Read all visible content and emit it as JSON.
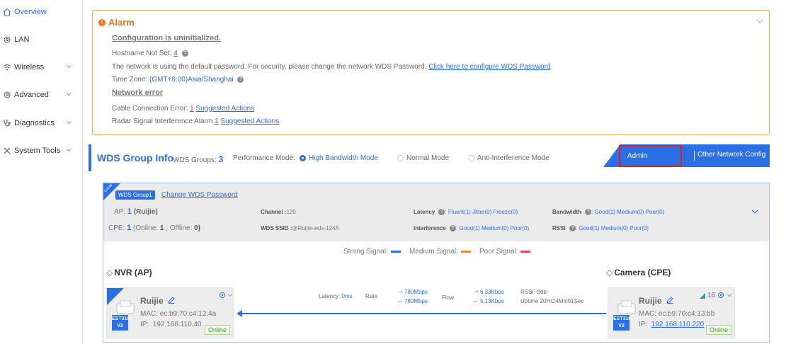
{
  "sidebar": {
    "items": [
      {
        "label": "Overview",
        "icon": "home-icon",
        "active": true
      },
      {
        "label": "LAN",
        "icon": "gear-icon"
      },
      {
        "label": "Wireless",
        "icon": "wifi-icon"
      },
      {
        "label": "Advanced",
        "icon": "gear-icon"
      },
      {
        "label": "Diagnostics",
        "icon": "stethoscope-icon"
      },
      {
        "label": "System Tools",
        "icon": "tools-icon"
      }
    ]
  },
  "alarm": {
    "title": "Alarm",
    "config_head": "Configuration is uninitialized.",
    "hostname_label": "Hostname Not Set:",
    "hostname_count": "4",
    "password_text": "The network is using the default password. For security, please change the network WDS Password.",
    "password_link": "Click here to configure WDS Password",
    "timezone_label": "Time Zone:",
    "timezone_value": "(GMT+8:00)Asia/Shanghai",
    "network_head": "Network error",
    "cable_label": "Cable Connection Error:",
    "cable_count": "1",
    "cable_link": "Suggested Actions",
    "radar_label": "Radar Signal Interference Alarm",
    "radar_count": "1",
    "radar_link": "Suggested Actions"
  },
  "wds": {
    "title": "WDS Group Info",
    "groups_label": "WDS Groups:",
    "groups_count": "3",
    "perf_label": "Performance Mode:",
    "modes": [
      "High Bandwidth Mode",
      "Normal Mode",
      "Anti-Interference Mode"
    ],
    "admin_password": "Admin Password",
    "other_config": "Other Network Config"
  },
  "group": {
    "corner_label": "Local",
    "badge": "WDS Group1",
    "change_link": "Change WDS Password",
    "ap_label": "AP:",
    "ap_count": "1",
    "ap_name": "(Ruijie)",
    "cpe_label": "CPE:",
    "cpe_count": "1",
    "cpe_online_label": "(Online:",
    "cpe_online": "1",
    "cpe_offline_label": ", Offline:",
    "cpe_offline": "0)",
    "channel_label": "Channel :",
    "channel_value": "120",
    "ssid_label": "WDS SSID :",
    "ssid_value": "@Ruijie-wds-124A",
    "latency_label": "Latency",
    "latency_value": ": Fluent(1)  Jitter(0)  Freeze(0)",
    "interference_label": "Interference",
    "interference_value": ": Good(1)  Medium(0)  Poor(0)",
    "bandwidth_label": "Bandwidth",
    "bandwidth_value": ": Good(1)  Medium(0)  Poor(0)",
    "rssi_label": "RSSI",
    "rssi_value": ": Good(1)  Medium(0)  Poor(0)"
  },
  "legend": {
    "strong": "Strong Signal:",
    "medium": "Medium Signal:",
    "poor": "Poor Signal:",
    "strong_color": "#2b6fe6",
    "medium_color": "#f08a3a",
    "poor_color": "#e8427a"
  },
  "nvr": {
    "title": "NVR (AP)",
    "corner_label": "Local",
    "name": "Ruijie",
    "model_line1": "EST310-",
    "model_line2": "V2",
    "mac": "MAC:  ec:b9:70:c4:12:4a",
    "ip_label": "IP:",
    "ip": "192.168.110.40",
    "status": "Online"
  },
  "camera": {
    "title": "Camera (CPE)",
    "name": "Ruijie",
    "model_line1": "EST310-",
    "model_line2": "V2",
    "signal": "16",
    "mac": "MAC:  ec:b9:70:c4:13:bb",
    "ip_label": "IP:",
    "ip": "192.168.110.220",
    "status": "Online"
  },
  "link": {
    "latency_label": "Latency",
    "latency_value": "0ms",
    "rate_label": "Rate",
    "rate_up": "780Mbps",
    "rate_down": "780Mbps",
    "flow_label": "Flow",
    "flow_up": "6.33Kbps",
    "flow_down": "5.13Kbps",
    "rssi": "RSSI -9db",
    "uptime": "Uptime 20Hr24Min01Sec"
  }
}
